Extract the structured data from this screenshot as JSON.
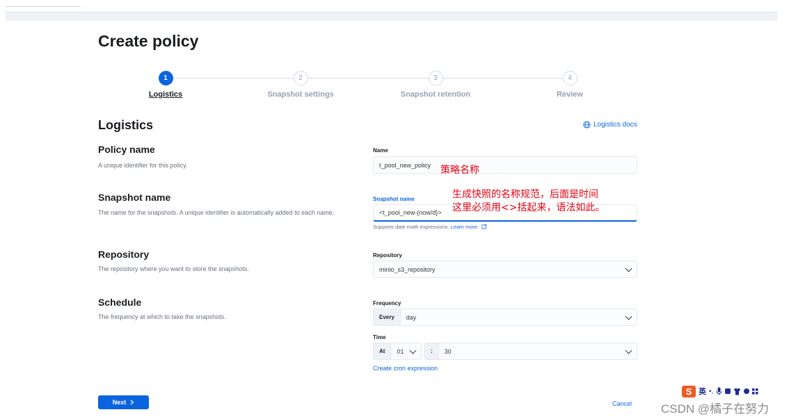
{
  "page": {
    "title": "Create policy"
  },
  "steps": [
    {
      "number": "1",
      "label": "Logistics",
      "active": true
    },
    {
      "number": "2",
      "label": "Snapshot settings",
      "active": false
    },
    {
      "number": "3",
      "label": "Snapshot retention",
      "active": false
    },
    {
      "number": "4",
      "label": "Review",
      "active": false
    }
  ],
  "section": {
    "title": "Logistics",
    "docs_link": "Logistics docs"
  },
  "policy_name": {
    "title": "Policy name",
    "description": "A unique identifier for this policy.",
    "label": "Name",
    "value": "t_pool_new_policy"
  },
  "snapshot_name": {
    "title": "Snapshot name",
    "description": "The name for the snapshots. A unique identifier is automatically added to each name.",
    "label": "Snapshot name",
    "value": "<t_pool_new-{now/d}>",
    "help": "Supports date math expressions.",
    "learn_more": "Learn more."
  },
  "repository": {
    "title": "Repository",
    "description": "The repository where you want to store the snapshots.",
    "label": "Repository",
    "value": "minio_s3_repository"
  },
  "schedule": {
    "title": "Schedule",
    "description": "The frequency at which to take the snapshots.",
    "frequency_label": "Frequency",
    "frequency_prepend": "Every",
    "frequency_value": "day",
    "time_label": "Time",
    "time_prepend": "At",
    "hour_value": "01",
    "minute_prepend": ":",
    "minute_value": "30",
    "cron_link": "Create cron expression"
  },
  "annotations": {
    "policy_note": "策略名称",
    "snapshot_note_line1": "生成快照的名称规范，后面是时间",
    "snapshot_note_line2": "这里必须用<>括起来，语法如此。"
  },
  "footer": {
    "next": "Next",
    "cancel": "Cancel"
  },
  "overlay": {
    "ime_s": "S",
    "ime_lang": "英",
    "watermark": "CSDN @橘子在努力"
  },
  "colors": {
    "primary": "#0b64dd",
    "annotation": "#e60012"
  }
}
